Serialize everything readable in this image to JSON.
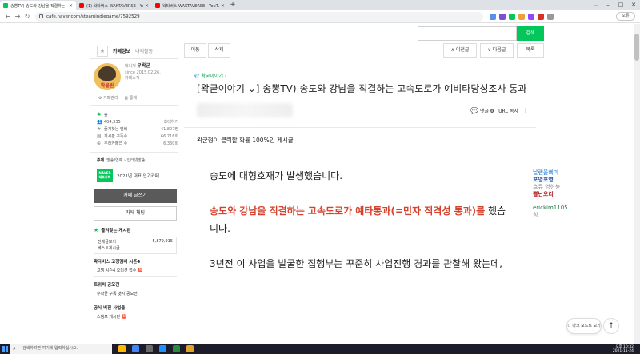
{
  "browser": {
    "tabs": [
      {
        "label": "송뽕TV) 송도와 강남을 직결하는",
        "active": true,
        "favicon": "naver-cafe"
      },
      {
        "label": "(1) 왁타버스 WAKTAVERSE - Yo",
        "active": false,
        "favicon": "youtube"
      },
      {
        "label": "왁타버스 WAKTAVERSE - YouTu",
        "active": false,
        "favicon": "youtube"
      }
    ],
    "new_tab": "+",
    "window_controls": {
      "minimize": "–",
      "maximize": "□",
      "close": "✕"
    },
    "url": "cafe.naver.com/steamindiegame/7592529",
    "profile_label": "오류"
  },
  "cafe_search": {
    "placeholder": "",
    "button": "검색"
  },
  "sidebar": {
    "tab_info": "카페정보",
    "tab_activity": "나의활동",
    "manager_label": "매니저",
    "manager_name": "우왁굳",
    "since": "since 2015.02.26.",
    "cafe_intro": "카페소개",
    "avatar_text": "왁물원",
    "manage_link": "카페관리",
    "stats_link": "통계",
    "level": "숲",
    "members": "404,335",
    "invite": "초대하기",
    "stats": [
      {
        "label": "즐겨찾는 멤버",
        "value": "41,807명"
      },
      {
        "label": "게시판 구독수",
        "value": "66,716회"
      },
      {
        "label": "우리카페앱 수",
        "value": "6,330회"
      }
    ],
    "topic_label": "주제",
    "topic_value": "방송/연예 › 인터넷방송",
    "award_logo": "NAVER 대표카페",
    "award_text": "2021년 대표 인기카페",
    "write_button": "카페 글쓰기",
    "chat_button": "카페 채팅",
    "fav_boards_title": "즐겨찾는 게시판",
    "fav_menu": [
      {
        "label": "전체글보기",
        "count": "5,879,915"
      },
      {
        "label": "베스트게시글",
        "count": ""
      }
    ],
    "group1": "왁타버스 고정멤버 시즌4",
    "group1_item": "고멤 시즌4 오디션 접수",
    "group2": "트위치 공모전",
    "group2_item": "수왁굳 구독 뱃지 공모전",
    "group3": "공식 비전 사업들",
    "group3_item": "스탬프 게시판"
  },
  "toolbar": {
    "move": "이동",
    "delete": "삭제",
    "prev": "∧ 이전글",
    "next": "∨ 다음글",
    "list": "목록"
  },
  "article": {
    "board": "💎 왁굳이야기 ›",
    "title": "[왁굳이야기 ⌄] 송뽕TV) 송도와 강남을 직결하는 고속도로가 예비타당성조사 통과",
    "comment_label": "댓글",
    "comment_count": "0",
    "url_copy": "URL 복사",
    "subline": "왁굳형이 클릭할 확률 100%인 게시글",
    "p1": "송도에 대형호재가 발생했습니다.",
    "p2_red": "송도와 강남을 직결하는 고속도로가 예타통과(=민자 적격성 통과)를",
    "p2_tail": " 했습니다.",
    "p3": "3년전 이 사업을 발굴한 집행부는 꾸준히 사업진행 경과를 관찰해 왔는데,"
  },
  "chat_overlay": [
    {
      "text": "날렌올삐미",
      "color": "#1a6fd0"
    },
    {
      "text": "포영포영",
      "color": "#2255aa"
    },
    {
      "text": "흐듀 엉힌뉸",
      "color": "#888888"
    },
    {
      "text": "뽈난오리",
      "color": "#b01818"
    },
    {
      "text": "erickim1105",
      "color": "#1f7a4a"
    },
    {
      "text": "힝",
      "color": "#888888"
    }
  ],
  "floating": {
    "dark_mode": "☾ 다크 모드로 보기",
    "to_top": "↑"
  },
  "taskbar": {
    "search_placeholder": "검색하려면 여기에 입력하십시오.",
    "time": "오후 10:32",
    "date": "2021-11-24"
  }
}
